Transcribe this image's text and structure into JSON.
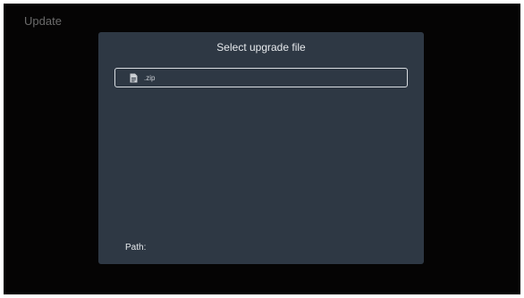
{
  "screen": {
    "title": "Update"
  },
  "dialog": {
    "title": "Select upgrade file",
    "files": [
      {
        "name": ".zip",
        "icon": "file-icon",
        "selected": true
      }
    ],
    "path_label": "Path:",
    "path_value": ""
  },
  "colors": {
    "screen_bg": "#050404",
    "dialog_bg": "#2e3844",
    "focus_border": "#d9dde2",
    "text": "#e6e9ec"
  }
}
